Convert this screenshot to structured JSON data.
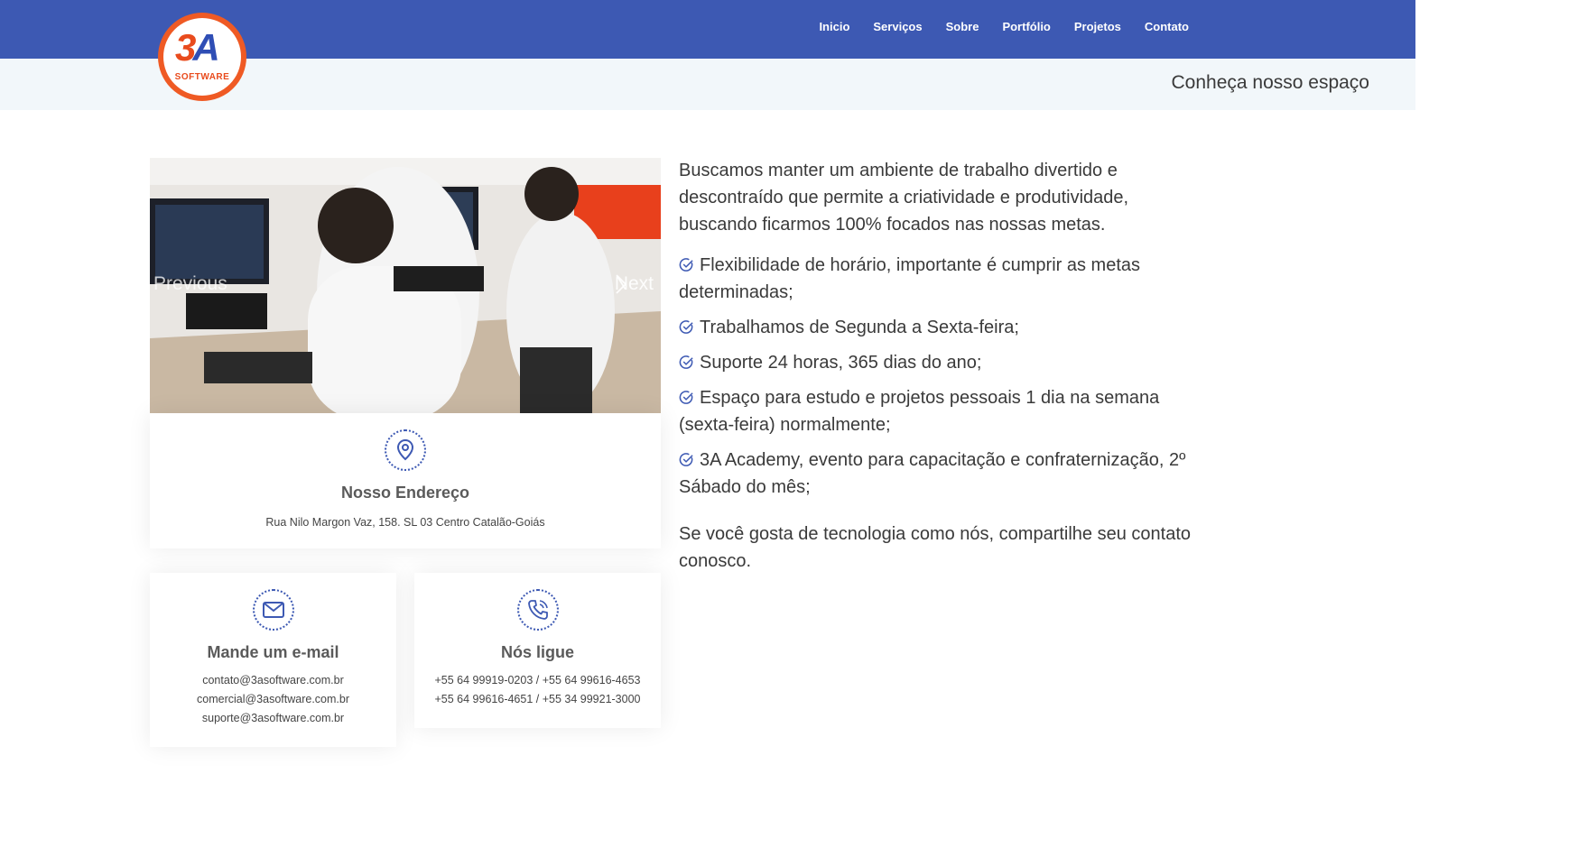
{
  "brand": {
    "logo_text": "3A",
    "logo_sub": "SOFTWARE"
  },
  "nav": {
    "items": [
      {
        "label": "Inicio"
      },
      {
        "label": "Serviços"
      },
      {
        "label": "Sobre"
      },
      {
        "label": "Portfólio"
      },
      {
        "label": "Projetos"
      },
      {
        "label": "Contato"
      }
    ]
  },
  "page": {
    "title": "Conheça nosso espaço"
  },
  "carousel": {
    "prev_label": "Previous",
    "next_label": "Next"
  },
  "address": {
    "title": "Nosso Endereço",
    "text": "Rua Nilo Margon Vaz, 158. SL 03 Centro Catalão-Goiás"
  },
  "email": {
    "title": "Mande um e-mail",
    "lines": [
      "contato@3asoftware.com.br",
      "comercial@3asoftware.com.br",
      "suporte@3asoftware.com.br"
    ]
  },
  "phone": {
    "title": "Nós ligue",
    "lines": [
      "+55 64 99919-0203 / +55 64 99616-4653",
      "+55 64 99616-4651 / +55 34 99921-3000"
    ]
  },
  "about": {
    "intro": "Buscamos manter um ambiente de trabalho divertido e descontraído que permite a criatividade e produtividade, buscando ficarmos 100% focados nas nossas metas.",
    "features": [
      "Flexibilidade de horário, importante é cumprir as metas determinadas;",
      "Trabalhamos de Segunda a Sexta-feira;",
      "Suporte 24 horas, 365 dias do ano;",
      "Espaço para estudo e projetos pessoais 1 dia na semana (sexta-feira) normalmente;",
      "3A Academy, evento para capacitação e confraternização, 2º Sábado do mês;"
    ],
    "outro": "Se você gosta de tecnologia como nós, compartilhe seu contato conosco."
  },
  "colors": {
    "primary": "#3d59b3",
    "accent": "#ef5a24",
    "subbar": "#f2f7fa"
  },
  "icons": [
    "location-pin-icon",
    "envelope-icon",
    "phone-icon",
    "check-circle-icon",
    "chevron-right-icon"
  ]
}
